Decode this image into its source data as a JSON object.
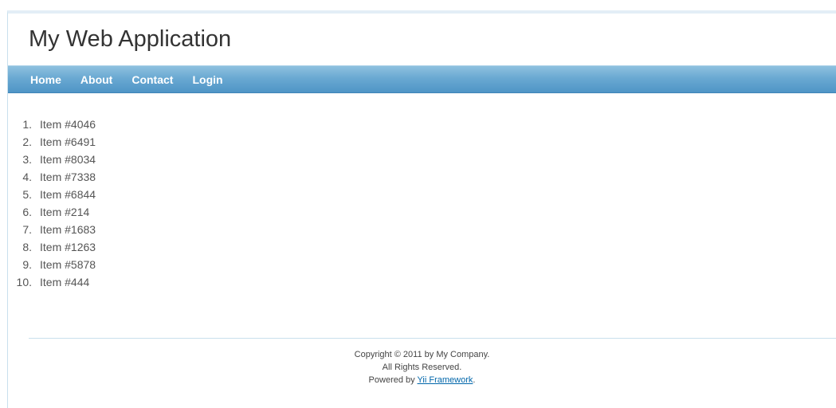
{
  "header": {
    "title": "My Web Application"
  },
  "nav": {
    "items": [
      {
        "label": "Home"
      },
      {
        "label": "About"
      },
      {
        "label": "Contact"
      },
      {
        "label": "Login"
      }
    ]
  },
  "content": {
    "items": [
      {
        "num": "1.",
        "label": "Item #4046"
      },
      {
        "num": "2.",
        "label": "Item #6491"
      },
      {
        "num": "3.",
        "label": "Item #8034"
      },
      {
        "num": "4.",
        "label": "Item #7338"
      },
      {
        "num": "5.",
        "label": "Item #6844"
      },
      {
        "num": "6.",
        "label": "Item #214"
      },
      {
        "num": "7.",
        "label": "Item #1683"
      },
      {
        "num": "8.",
        "label": "Item #1263"
      },
      {
        "num": "9.",
        "label": "Item #5878"
      },
      {
        "num": "10.",
        "label": "Item #444"
      }
    ]
  },
  "footer": {
    "copyright": "Copyright © 2011 by My Company.",
    "rights": "All Rights Reserved.",
    "powered_prefix": "Powered by ",
    "powered_link": "Yii Framework",
    "powered_suffix": "."
  },
  "colors": {
    "nav_bar": "#6aa9d2",
    "link": "#0066aa"
  }
}
